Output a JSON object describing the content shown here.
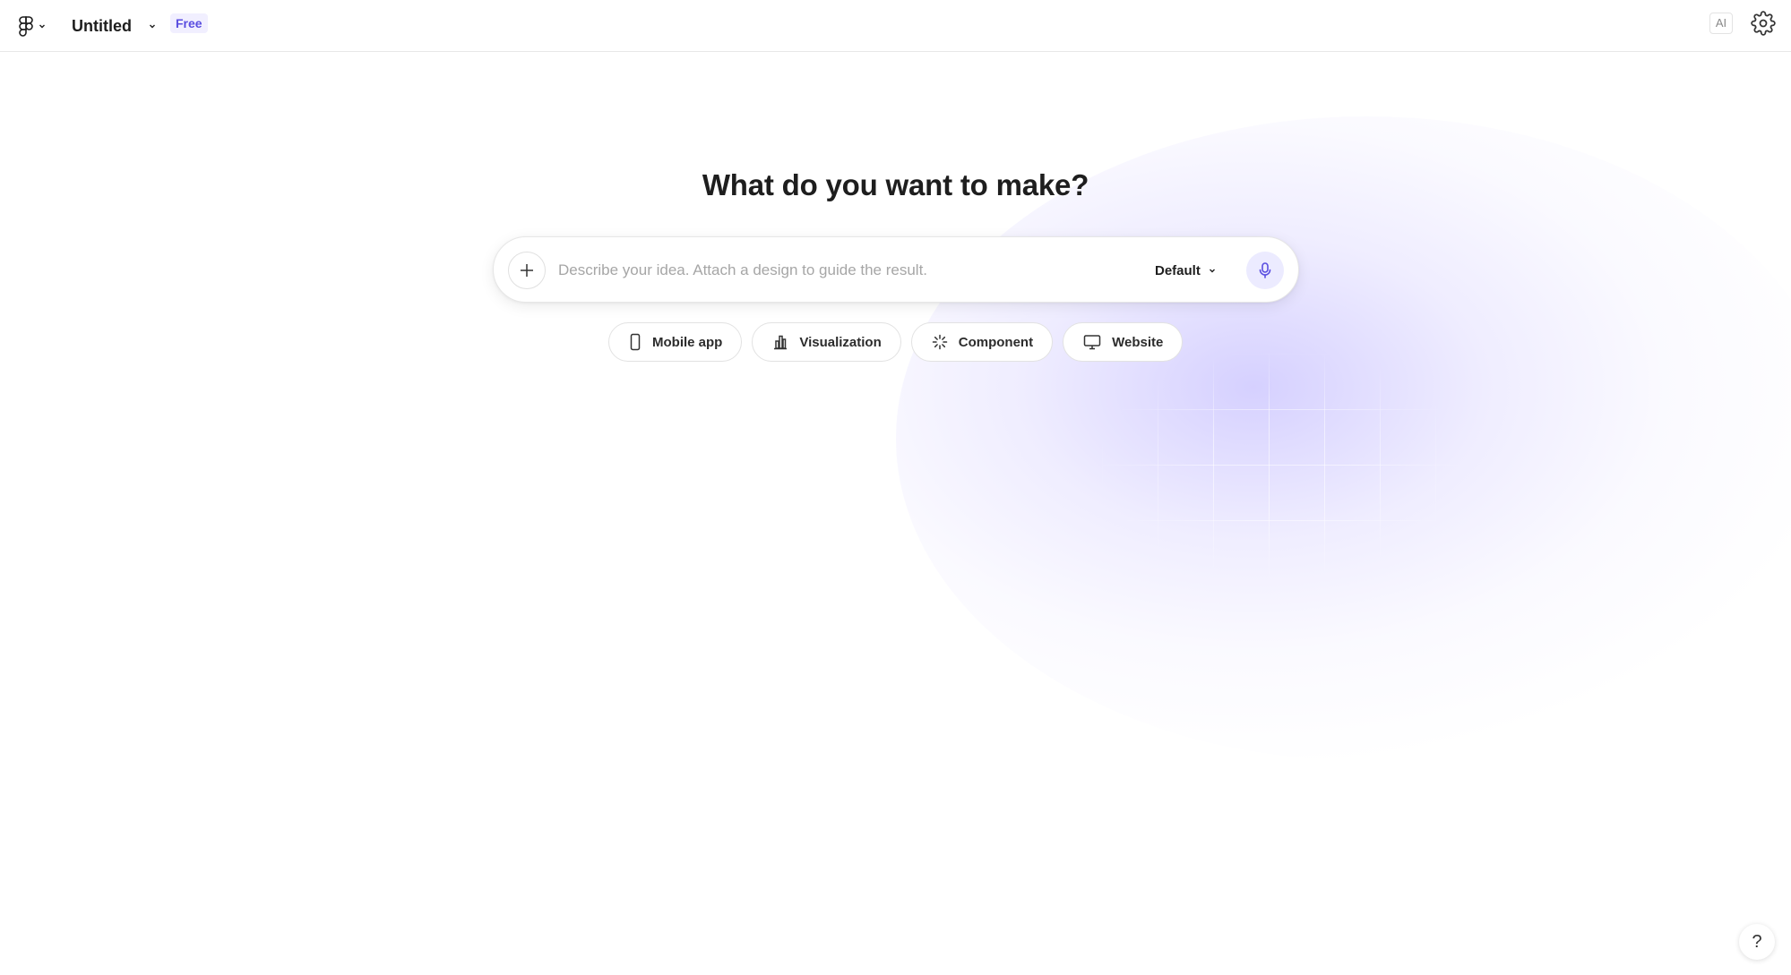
{
  "header": {
    "logo_icon": "figma-logo-icon",
    "title": "Untitled",
    "plan_badge": "Free",
    "ai_label": "AI",
    "settings_icon": "gear-icon"
  },
  "main": {
    "heading": "What do you want to make?",
    "prompt": {
      "placeholder": "Describe your idea. Attach a design to guide the result.",
      "value": "",
      "attach_icon": "plus-icon",
      "model_label": "Default",
      "mic_icon": "microphone-icon"
    },
    "suggestions": [
      {
        "label": "Mobile app",
        "icon": "phone-icon"
      },
      {
        "label": "Visualization",
        "icon": "bar-chart-icon"
      },
      {
        "label": "Component",
        "icon": "sparkle-icon"
      },
      {
        "label": "Website",
        "icon": "monitor-icon"
      }
    ]
  },
  "help": {
    "label": "?"
  },
  "colors": {
    "accent": "#5a4ee0",
    "accent_soft": "#ecebff",
    "glow": "#cec8ff"
  }
}
